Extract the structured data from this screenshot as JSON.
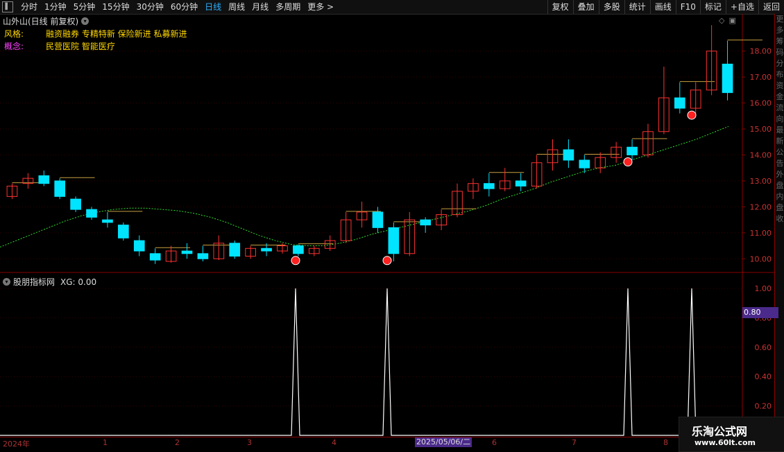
{
  "toolbar": {
    "periods": [
      "分时",
      "1分钟",
      "5分钟",
      "15分钟",
      "30分钟",
      "60分钟",
      "日线",
      "周线",
      "月线",
      "多周期",
      "更多 >"
    ],
    "active_period": "日线",
    "tools": [
      "复权",
      "叠加",
      "多股",
      "统计",
      "画线",
      "F10",
      "标记",
      "+自选",
      "返回"
    ]
  },
  "stock": {
    "title": "山外山(日线 前复权)",
    "style_label": "风格:",
    "style_value": "融资融券 专精特新 保险新进 私募新进",
    "concept_label": "概念:",
    "concept_value": "民营医院 智能医疗"
  },
  "right_strip_chars": [
    "更",
    "多",
    "筹",
    "码",
    "分",
    "布",
    "资",
    "金",
    "流",
    "向",
    "最",
    "新",
    "公",
    "告",
    "外",
    "盘",
    "内",
    "盘",
    "收"
  ],
  "main_axis_ticks": [
    "18.00",
    "17.00",
    "16.00",
    "15.00",
    "14.00",
    "13.00",
    "12.00",
    "11.00",
    "10.00"
  ],
  "sub_panel": {
    "title": "股朋指标网",
    "xg_label": "XG: 0.00",
    "axis_ticks": [
      "1.00",
      "0.80",
      "0.60",
      "0.40",
      "0.20"
    ],
    "value_badge": "0.80"
  },
  "date_axis": {
    "labels": [
      "2024年",
      "1",
      "2",
      "3",
      "4",
      "5",
      "6",
      "7",
      "8"
    ],
    "cursor_date": "2025/05/06/二"
  },
  "watermark": {
    "name": "乐淘公式网",
    "url": "www.60lt.com"
  },
  "colors": {
    "up": "#ff3232",
    "down": "#00e4ff",
    "ma": "#2ee02e",
    "signal": "#ffffff",
    "stub": "#c8a040",
    "active": "#2bb0ff",
    "style_text": "#ffd700",
    "concept_label": "#ff40ff"
  },
  "chart_data": {
    "type": "candlestick",
    "price_axis": [
      9.5,
      18.9
    ],
    "ma_series": [
      10.45,
      10.7,
      10.95,
      11.2,
      11.45,
      11.65,
      11.8,
      11.9,
      11.95,
      11.95,
      11.9,
      11.85,
      11.75,
      11.6,
      11.4,
      11.15,
      10.9,
      10.7,
      10.55,
      10.5,
      10.5,
      10.6,
      10.75,
      10.95,
      11.1,
      11.25,
      11.4,
      11.55,
      11.7,
      11.85,
      12.05,
      12.3,
      12.5,
      12.7,
      12.95,
      13.15,
      13.35,
      13.5,
      13.6,
      13.8,
      14.0,
      14.2,
      14.4,
      14.6,
      14.85,
      15.1
    ],
    "candles": [
      [
        12.4,
        12.8,
        12.3,
        12.9
      ],
      [
        12.9,
        13.1,
        12.7,
        13.3
      ],
      [
        13.2,
        12.9,
        12.8,
        13.4
      ],
      [
        13.0,
        12.4,
        12.3,
        13.1
      ],
      [
        12.3,
        11.9,
        11.8,
        12.4
      ],
      [
        11.9,
        11.6,
        11.5,
        12.0
      ],
      [
        11.5,
        11.4,
        11.2,
        11.8
      ],
      [
        11.3,
        10.8,
        10.7,
        11.4
      ],
      [
        10.7,
        10.3,
        10.1,
        10.9
      ],
      [
        10.2,
        9.95,
        9.8,
        10.4
      ],
      [
        9.9,
        10.3,
        9.85,
        10.5
      ],
      [
        10.3,
        10.2,
        10.0,
        10.6
      ],
      [
        10.2,
        10.0,
        9.9,
        10.5
      ],
      [
        10.0,
        10.6,
        9.95,
        10.9
      ],
      [
        10.6,
        10.1,
        10.0,
        10.7
      ],
      [
        10.1,
        10.4,
        10.0,
        10.5
      ],
      [
        10.4,
        10.3,
        10.1,
        10.6
      ],
      [
        10.3,
        10.5,
        10.2,
        10.6
      ],
      [
        10.5,
        10.2,
        10.1,
        10.55
      ],
      [
        10.2,
        10.4,
        10.1,
        10.5
      ],
      [
        10.4,
        10.7,
        10.3,
        10.9
      ],
      [
        10.7,
        11.5,
        10.6,
        11.8
      ],
      [
        11.5,
        11.8,
        11.2,
        12.2
      ],
      [
        11.8,
        11.2,
        11.0,
        12.0
      ],
      [
        11.2,
        10.2,
        9.9,
        11.4
      ],
      [
        10.2,
        11.5,
        10.1,
        11.8
      ],
      [
        11.5,
        11.3,
        11.0,
        11.6
      ],
      [
        11.3,
        11.7,
        11.1,
        11.9
      ],
      [
        11.7,
        12.6,
        11.6,
        12.9
      ],
      [
        12.6,
        12.9,
        12.3,
        13.1
      ],
      [
        12.9,
        12.7,
        12.4,
        13.3
      ],
      [
        12.7,
        13.0,
        12.6,
        13.5
      ],
      [
        13.0,
        12.8,
        12.6,
        13.3
      ],
      [
        12.8,
        13.7,
        12.7,
        14.0
      ],
      [
        13.7,
        14.2,
        13.4,
        14.6
      ],
      [
        14.2,
        13.8,
        13.5,
        14.6
      ],
      [
        13.8,
        13.5,
        13.3,
        14.0
      ],
      [
        13.5,
        13.9,
        13.3,
        14.1
      ],
      [
        13.9,
        14.3,
        13.7,
        14.5
      ],
      [
        14.3,
        14.0,
        13.8,
        14.6
      ],
      [
        14.0,
        14.9,
        13.9,
        15.2
      ],
      [
        14.9,
        16.2,
        14.8,
        17.4
      ],
      [
        16.2,
        15.8,
        15.6,
        16.8
      ],
      [
        15.8,
        16.5,
        15.5,
        16.8
      ],
      [
        16.5,
        18.0,
        16.3,
        19.0
      ],
      [
        17.5,
        16.4,
        16.1,
        18.4
      ]
    ],
    "signal_x": [
      426,
      558,
      905,
      997
    ],
    "signal_values": [
      1,
      1,
      1,
      1
    ],
    "signal_axis": [
      0,
      1.0
    ]
  }
}
